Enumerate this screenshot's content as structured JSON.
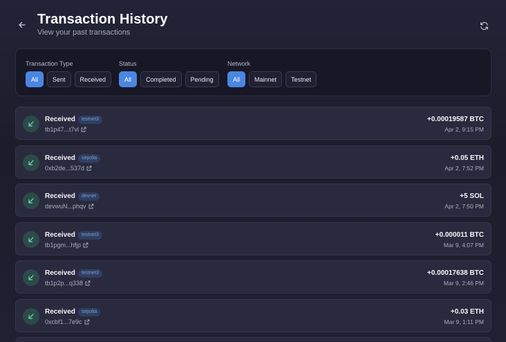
{
  "header": {
    "title": "Transaction History",
    "subtitle": "View your past transactions",
    "back_icon": "arrow-left-icon",
    "refresh_icon": "refresh-icon"
  },
  "filters": {
    "type": {
      "label": "Transaction Type",
      "options": [
        "All",
        "Sent",
        "Received"
      ],
      "selected": "All"
    },
    "status": {
      "label": "Status",
      "options": [
        "All",
        "Completed",
        "Pending"
      ],
      "selected": "All"
    },
    "network": {
      "label": "Network",
      "options": [
        "All",
        "Mainnet",
        "Testnet"
      ],
      "selected": "All"
    }
  },
  "colors": {
    "accent": "#4b86e0",
    "received_icon_bg": "#2c4a4a",
    "received_icon_fg": "#6fcfa8",
    "badge_bg": "#2f3f63"
  },
  "transactions": [
    {
      "type": "Received",
      "network": "testnet3",
      "hash": "tb1p47...t7vl",
      "amount": "+0.00019587 BTC",
      "time": "Apr 2, 9:15 PM"
    },
    {
      "type": "Received",
      "network": "sepolia",
      "hash": "0xb2de...537d",
      "amount": "+0.05 ETH",
      "time": "Apr 2, 7:52 PM"
    },
    {
      "type": "Received",
      "network": "devnet",
      "hash": "devwuN...phqv",
      "amount": "+5 SOL",
      "time": "Apr 2, 7:50 PM"
    },
    {
      "type": "Received",
      "network": "testnet3",
      "hash": "tb1pgm...hfjp",
      "amount": "+0.000011 BTC",
      "time": "Mar 9, 4:07 PM"
    },
    {
      "type": "Received",
      "network": "testnet3",
      "hash": "tb1p2p...q338",
      "amount": "+0.00017638 BTC",
      "time": "Mar 9, 2:46 PM"
    },
    {
      "type": "Received",
      "network": "sepolia",
      "hash": "0xcbf1...7e9c",
      "amount": "+0.03 ETH",
      "time": "Mar 9, 1:11 PM"
    }
  ]
}
